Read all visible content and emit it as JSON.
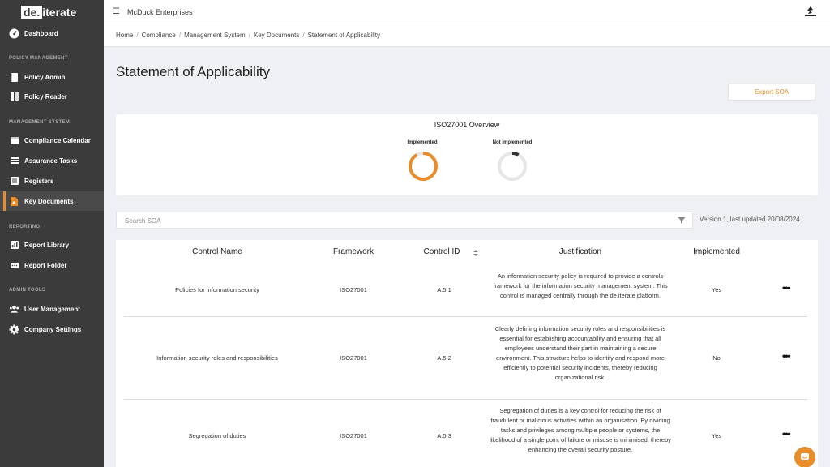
{
  "app": {
    "logo_box": "de.",
    "logo_text": "iterate",
    "org_name": "McDuck Enterprises"
  },
  "sidebar": {
    "dashboard": "Dashboard",
    "sections": {
      "policy": "POLICY MANAGEMENT",
      "management": "MANAGEMENT SYSTEM",
      "reporting": "REPORTING",
      "admin": "ADMIN TOOLS"
    },
    "items": {
      "policy_admin": "Policy Admin",
      "policy_reader": "Policy Reader",
      "compliance_calendar": "Compliance Calendar",
      "assurance_tasks": "Assurance Tasks",
      "registers": "Registers",
      "key_documents": "Key Documents",
      "report_library": "Report Library",
      "report_folder": "Report Folder",
      "user_management": "User Management",
      "company_settings": "Company Settings"
    }
  },
  "breadcrumb": [
    "Home",
    "Compliance",
    "Management System",
    "Key Documents",
    "Statement of Applicability"
  ],
  "page": {
    "title": "Statement of Applicability",
    "export_label": "Export SOA"
  },
  "overview": {
    "title": "ISO27001 Overview",
    "implemented_label": "Implemented",
    "not_implemented_label": "Not implemented",
    "implemented_fraction": 0.92,
    "not_implemented_fraction": 0.08,
    "colors": {
      "implemented": "#e88d2a",
      "not_implemented": "#333333",
      "track": "#e6e6e6"
    }
  },
  "search": {
    "placeholder": "Search SOA",
    "version_text": "Version 1, last updated 20/08/2024"
  },
  "table": {
    "headers": {
      "control_name": "Control Name",
      "framework": "Framework",
      "control_id": "Control ID",
      "justification": "Justification",
      "implemented": "Implemented"
    },
    "rows": [
      {
        "control_name": "Policies for information security",
        "framework": "ISO27001",
        "control_id": "A.5.1",
        "justification": "An information security policy is required to provide a controls framework for the information security management system. This control is managed centrally through the de.iterate platform.",
        "implemented": "Yes"
      },
      {
        "control_name": "Information security roles and responsibilities",
        "framework": "ISO27001",
        "control_id": "A.5.2",
        "justification": "Clearly defining information security roles and responsibilities is essential for establishing accountability and ensuring that all employees understand their part in maintaining a secure environment. This structure helps to identify and respond more efficiently to potential security incidents, thereby reducing organizational risk.",
        "implemented": "No"
      },
      {
        "control_name": "Segregation of duties",
        "framework": "ISO27001",
        "control_id": "A.5.3",
        "justification": "Segregation of duties is a key control for reducing the risk of fraudulent or malicious activities within an organisation. By dividing tasks and privileges among multiple people or systems, the likelihood of a single point of failure or misuse is minimised, thereby enhancing the overall security posture.",
        "implemented": "Yes"
      }
    ]
  },
  "icons": {
    "dashboard": "gauge-icon",
    "policy_admin": "book-icon",
    "policy_reader": "reader-icon",
    "compliance_calendar": "calendar-icon",
    "assurance_tasks": "tasks-icon",
    "registers": "register-icon",
    "key_documents": "document-icon",
    "report_library": "library-icon",
    "report_folder": "folder-icon",
    "user_management": "users-icon",
    "company_settings": "gear-icon"
  }
}
